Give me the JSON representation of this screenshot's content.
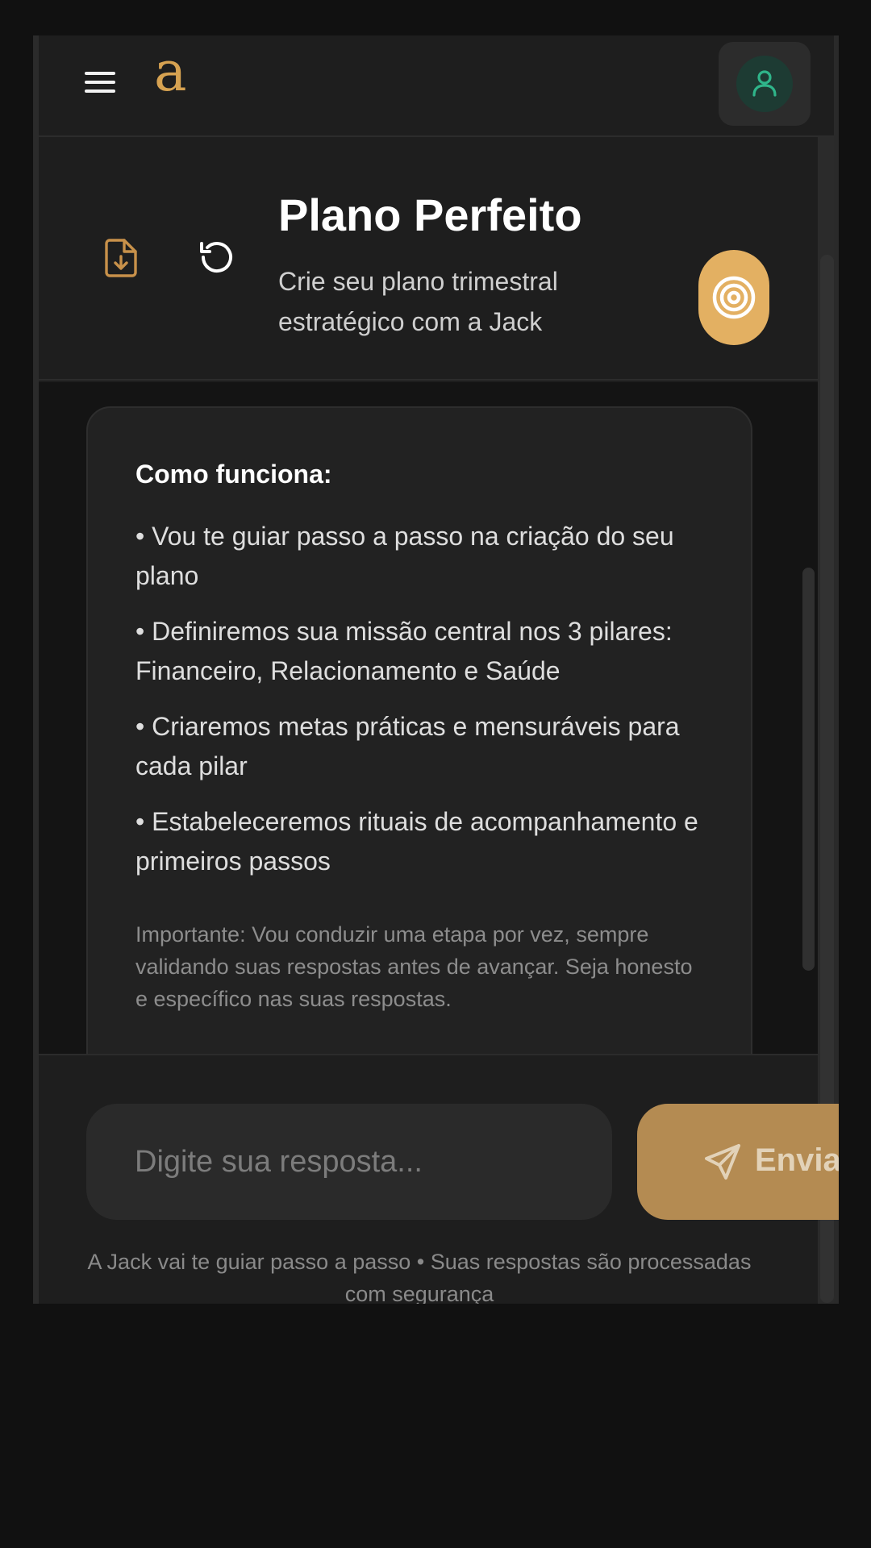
{
  "topbar": {
    "logo": "a",
    "menu_icon": "hamburger-menu-icon",
    "avatar_icon": "user-icon"
  },
  "header": {
    "title": "Plano Perfeito",
    "subtitle": "Crie seu plano trimestral estratégico com a Jack",
    "download_icon": "file-download-icon",
    "reset_icon": "rotate-ccw-icon",
    "badge_icon": "target-icon"
  },
  "card": {
    "heading": "Como funciona:",
    "bullets": [
      "• Vou te guiar passo a passo na criação do seu plano",
      "• Definiremos sua missão central nos 3 pilares: Financeiro, Relacionamento e Saúde",
      "• Criaremos metas práticas e mensuráveis para cada pilar",
      "• Estabeleceremos rituais de acompanhamento e primeiros passos"
    ],
    "note": "Importante: Vou conduzir uma etapa por vez, sempre validando suas respostas antes de avançar. Seja honesto e específico nas suas respostas."
  },
  "composer": {
    "placeholder": "Digite sua resposta...",
    "send_label": "Enviar",
    "send_icon": "send-icon",
    "footer": "A Jack vai te guiar passo a passo • Suas respostas são processadas com segurança"
  },
  "colors": {
    "accent": "#e3b062",
    "logo": "#d6a251",
    "send_button": "#b48b52",
    "avatar_bg": "#1d3b33",
    "avatar_icon": "#2fb58a",
    "background": "#111111",
    "panel": "#1e1e1e"
  }
}
